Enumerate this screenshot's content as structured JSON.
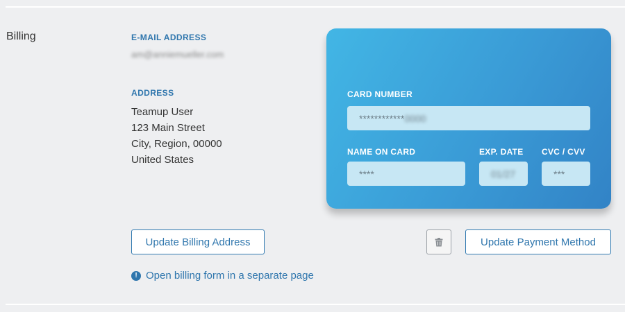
{
  "section": {
    "title": "Billing"
  },
  "email": {
    "label": "E-MAIL ADDRESS",
    "value": "am@anniemueller.com"
  },
  "address": {
    "label": "ADDRESS",
    "lines": [
      "Teamup User",
      "123 Main Street",
      "City, Region, 00000",
      "United States"
    ]
  },
  "card": {
    "number_label": "CARD NUMBER",
    "number_value": "************",
    "number_suffix": "0000",
    "name_label": "NAME ON CARD",
    "name_value": "****",
    "exp_label": "EXP. DATE",
    "exp_value": "01/27",
    "cvc_label": "CVC / CVV",
    "cvc_value": "***"
  },
  "buttons": {
    "update_billing": "Update Billing Address",
    "update_payment": "Update Payment Method",
    "delete_icon": "trash-icon"
  },
  "link": {
    "icon": "info-icon",
    "icon_glyph": "!",
    "text": "Open billing form in a separate page"
  },
  "colors": {
    "accent": "#2f76ad",
    "card_gradient_start": "#42b6e5",
    "card_gradient_end": "#3283c6",
    "field_background": "#c7e7f4"
  }
}
